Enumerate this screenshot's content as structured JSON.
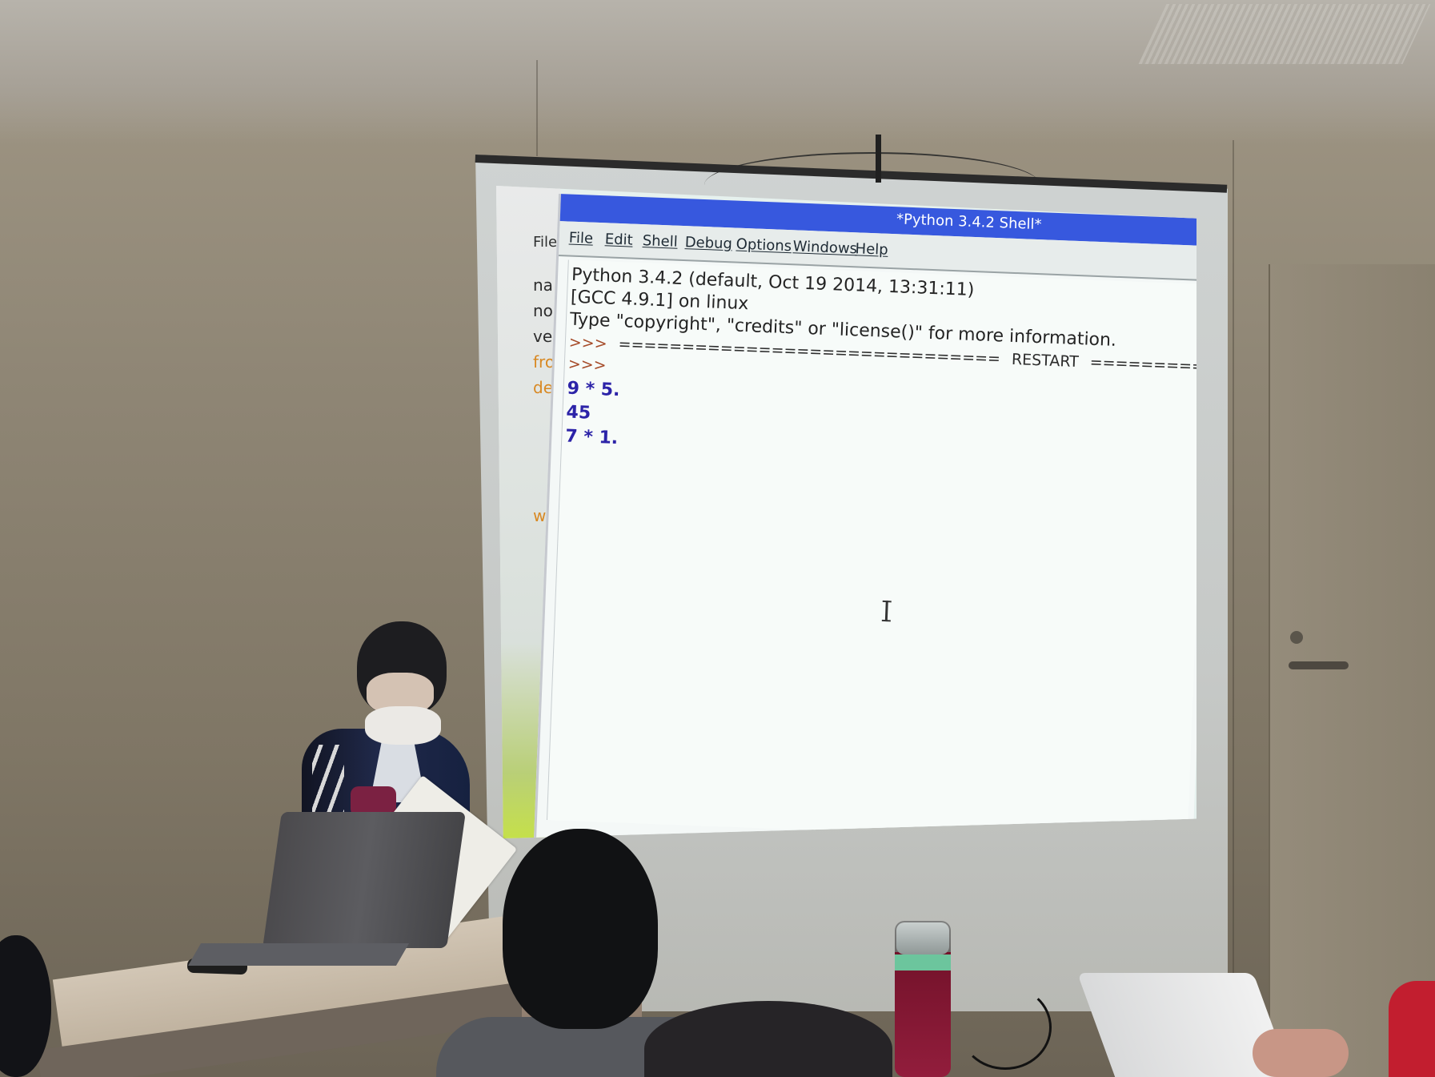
{
  "scene": {
    "shell_window": {
      "title": "*Python 3.4.2 Shell*",
      "menu": [
        "File",
        "Edit",
        "Shell",
        "Debug",
        "Options",
        "Windows",
        "Help"
      ],
      "lines": [
        "Python 3.4.2 (default, Oct 19 2014, 13:31:11)",
        "[GCC 4.9.1] on linux",
        "Type \"copyright\", \"credits\" or \"license()\" for more information."
      ],
      "restart_prompt": ">>>",
      "restart_rule": "==============================",
      "restart_label": "RESTART",
      "restart_rule_tail": "=========================",
      "prompt": ">>>",
      "inputs": [
        "9 * 5.",
        "45",
        "7 * 1."
      ]
    },
    "back_window": {
      "menu_label": "File",
      "code_fragments": [
        "na",
        "no",
        "ve",
        "fro",
        "de",
        "wh"
      ]
    }
  }
}
